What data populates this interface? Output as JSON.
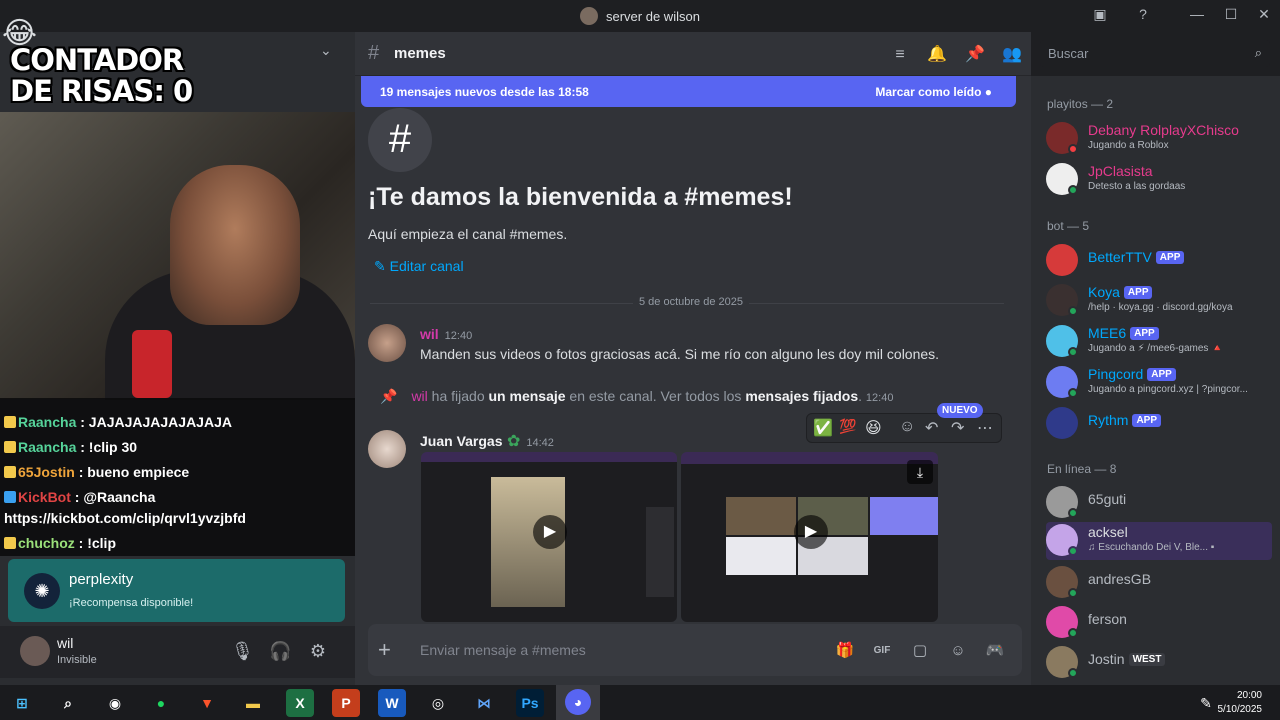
{
  "window": {
    "title": "server de wilson"
  },
  "stream": {
    "counter_line1": "CONTADOR",
    "counter_line2": "DE RISAS: 0",
    "chat": [
      {
        "user": "Raancha",
        "text": ": JAJAJAJAJAJAJAJA"
      },
      {
        "user": "Raancha",
        "text": ": !clip 30"
      },
      {
        "user": "65Jostin",
        "text": ": bueno empiece"
      },
      {
        "user": "KickBot",
        "text": ": @Raancha"
      },
      {
        "user": "",
        "text": "https://kickbot.com/clip/qrvl1yvzjbfd"
      },
      {
        "user": "chuchoz",
        "text": ": !clip"
      }
    ]
  },
  "promo": {
    "title": "perplexity",
    "subtitle": "¡Recompensa disponible!"
  },
  "user": {
    "name": "wil",
    "status": "Invisible"
  },
  "channel": {
    "name": "memes",
    "search_placeholder": "Buscar",
    "new_messages": "19 mensajes nuevos desde las 18:58",
    "mark_read": "Marcar como leído",
    "welcome_title": "¡Te damos la bienvenida a #memes!",
    "welcome_sub": "Aquí empieza el canal #memes.",
    "edit_channel": "Editar canal",
    "date_divider": "5 de octubre de 2025",
    "composer_placeholder": "Enviar mensaje a #memes"
  },
  "messages": [
    {
      "author": "wil",
      "time": "12:40",
      "text": "Manden sus videos o fotos graciosas acá. Si me río con alguno les doy mil colones."
    },
    {
      "author": "Juan Vargas",
      "time": "14:42"
    }
  ],
  "pin_notice": {
    "author": "wil",
    "pre": "ha fijado",
    "b1": "un mensaje",
    "mid": "en este canal. Ver todos los",
    "b2": "mensajes fijados",
    "end": ".",
    "time": "12:40"
  },
  "new_tag": "NUEVO",
  "members": {
    "group1": "playitos — 2",
    "group2": "bot — 5",
    "group3": "En línea — 8",
    "playitos": [
      {
        "name": "Debany RolplayXChisco",
        "status": "Jugando a Roblox"
      },
      {
        "name": "JpClasista",
        "status": "Detesto a las gordaas"
      }
    ],
    "bots": [
      {
        "name": "BetterTTV",
        "badge": "APP",
        "status": ""
      },
      {
        "name": "Koya",
        "badge": "APP",
        "status": "/help · koya.gg · discord.gg/koya"
      },
      {
        "name": "MEE6",
        "badge": "APP",
        "status": "Jugando a ⚡ /mee6-games 🔺"
      },
      {
        "name": "Pingcord",
        "badge": "APP",
        "status": "Jugando a pingcord.xyz | ?pingcor..."
      },
      {
        "name": "Rythm",
        "badge": "APP",
        "status": ""
      }
    ],
    "online": [
      {
        "name": "65guti",
        "status": ""
      },
      {
        "name": "acksel",
        "status": "♫ Escuchando Dei V, Ble... ▪"
      },
      {
        "name": "andresGB",
        "status": ""
      },
      {
        "name": "ferson",
        "status": ""
      },
      {
        "name": "Jostin",
        "tag": "WEST",
        "status": ""
      }
    ]
  },
  "clock": {
    "time": "20:00",
    "date": "5/10/2025"
  },
  "colors": {
    "accent": "#5865f2",
    "online": "#23a55a",
    "link": "#00a8fc"
  }
}
